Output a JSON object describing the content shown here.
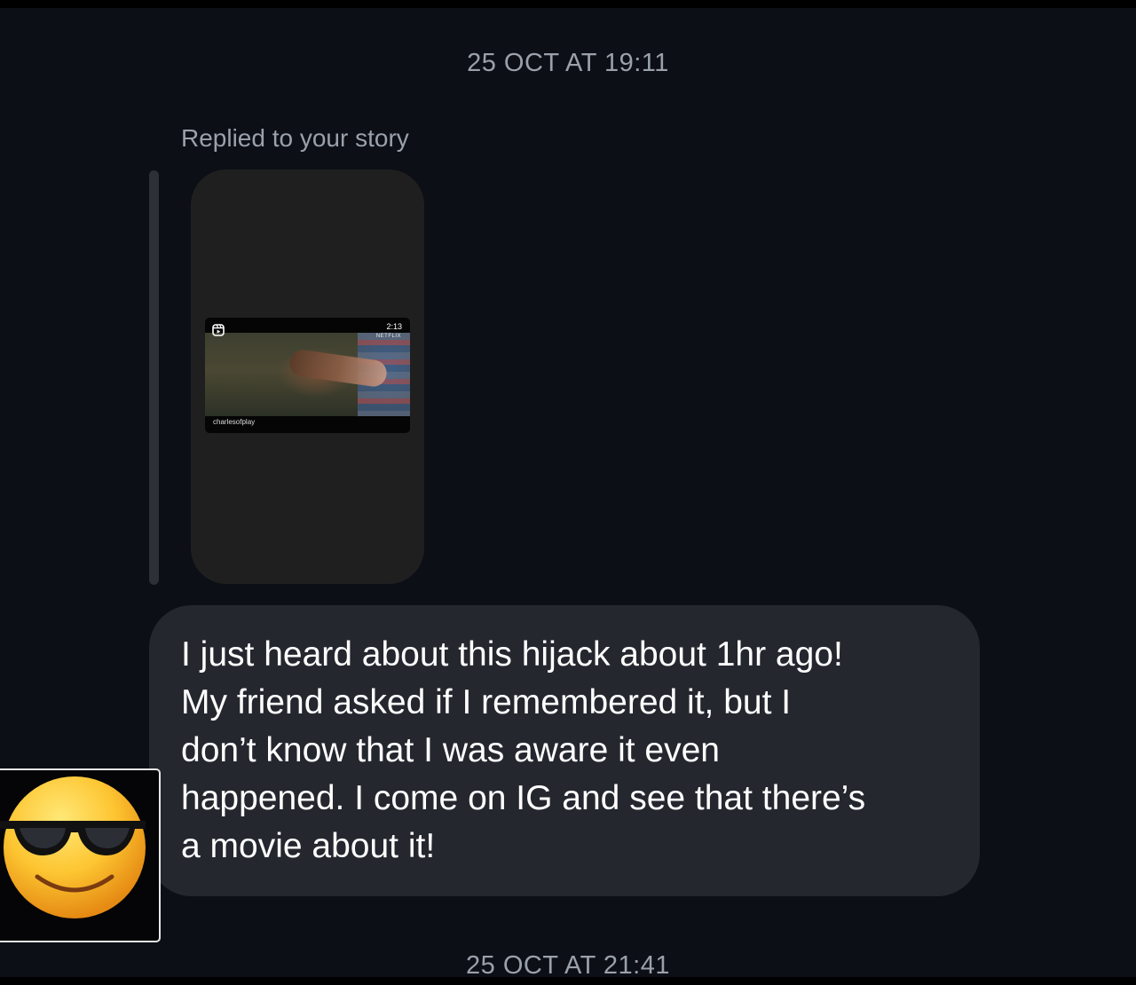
{
  "conversation": {
    "timestamp_top": "25 OCT AT 19:11",
    "timestamp_bottom": "25 OCT AT 21:41",
    "reply_label": "Replied to your story",
    "story": {
      "reel_duration": "2:13",
      "reel_brand": "NETFLIX",
      "reel_username": "charlesofplay",
      "reel_icon": "reels-icon"
    },
    "message": "I just heard about this hijack about 1hr ago!\nMy friend asked if I remembered it, but I\ndon’t know that I was aware it even\nhappened. I come on IG and see that there’s\na movie about it!",
    "reaction_emoji": "smiling-face-with-sunglasses-icon"
  },
  "colors": {
    "background": "#0c0f15",
    "bubble": "#24272e",
    "story_card": "#1f1f20",
    "muted_text": "#9aa1ab"
  }
}
